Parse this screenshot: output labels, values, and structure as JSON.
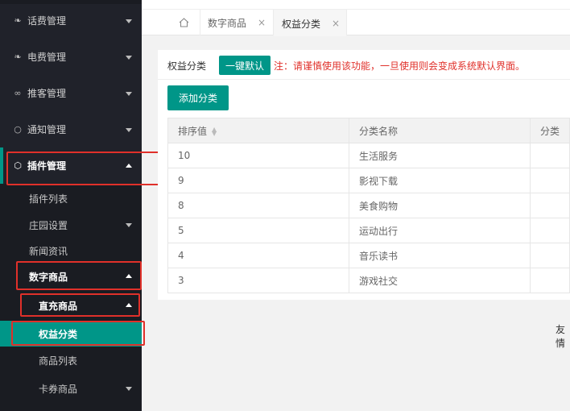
{
  "sidebar": {
    "groups": [
      {
        "label": "话费管理",
        "icon": "flame-icon"
      },
      {
        "label": "电费管理",
        "icon": "flame-icon"
      },
      {
        "label": "推客管理",
        "icon": "infinity-icon"
      },
      {
        "label": "通知管理",
        "icon": "circle-icon"
      },
      {
        "label": "插件管理",
        "icon": "box-icon"
      }
    ],
    "plugin_items": {
      "plugin_list": "插件列表",
      "farm_settings": "庄园设置",
      "news": "新闻资讯",
      "digital_goods": "数字商品",
      "direct_goods": "直充商品",
      "rights_category": "权益分类",
      "goods_list": "商品列表",
      "coupon_goods": "卡券商品"
    }
  },
  "tabs": {
    "home_icon": "home-icon",
    "items": [
      {
        "label": "数字商品",
        "close": "×"
      },
      {
        "label": "权益分类",
        "close": "×"
      }
    ]
  },
  "main": {
    "rule_label": "权益分类",
    "default_button": "一键默认",
    "warning": "注：请谨慎使用该功能，一旦使用则会变成系统默认界面。",
    "add_button": "添加分类",
    "table": {
      "headers": [
        "排序值",
        "分类名称",
        "分类"
      ],
      "rows": [
        [
          "10",
          "生活服务"
        ],
        [
          "9",
          "影视下载"
        ],
        [
          "8",
          "美食购物"
        ],
        [
          "5",
          "运动出行"
        ],
        [
          "4",
          "音乐读书"
        ],
        [
          "3",
          "游戏社交"
        ]
      ]
    },
    "footer_text": "友情"
  },
  "colors": {
    "accent": "#009688",
    "sidebar_bg": "#20222a",
    "warning": "#e0302a"
  }
}
